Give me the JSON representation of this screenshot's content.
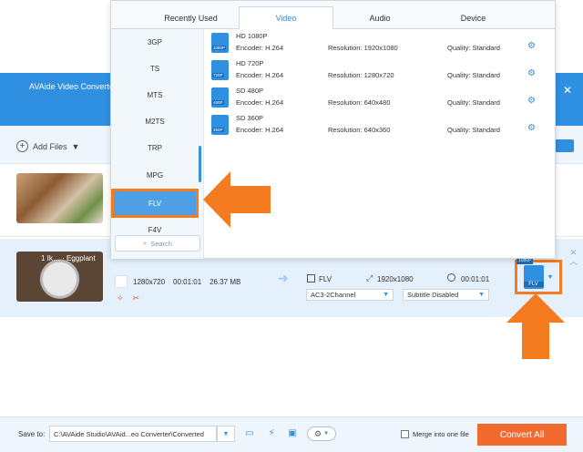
{
  "app": {
    "title": "AVAide Video Converter (",
    "close_glyph": "✕"
  },
  "toolbar": {
    "add_files_label": "Add Files",
    "add_files_caret": "▼"
  },
  "file_row": {
    "thumb_title": "1 Ik… · Eggplant",
    "resolution": "1280x720",
    "duration": "00:01:01",
    "size": "26.37 MB",
    "output_format": "FLV",
    "output_resolution": "1920x1080",
    "output_duration": "00:01:01",
    "audio_track": "AC3-2Channel",
    "subtitle": "Subtitle Disabled",
    "format_badge": "FLV",
    "format_tag": "1080P"
  },
  "popup": {
    "tabs": [
      {
        "label": "Recently Used"
      },
      {
        "label": "Video"
      },
      {
        "label": "Audio"
      },
      {
        "label": "Device"
      }
    ],
    "active_tab": "Video",
    "categories": [
      "3GP",
      "TS",
      "MTS",
      "M2TS",
      "TRP",
      "MPG",
      "FLV",
      "F4V"
    ],
    "selected_category": "FLV",
    "search_placeholder": "Search",
    "presets": [
      {
        "name": "HD 1080P",
        "icon_label": "1080P",
        "encoder": "Encoder: H.264",
        "resolution": "Resolution: 1920x1080",
        "quality": "Quality: Standard"
      },
      {
        "name": "HD 720P",
        "icon_label": "720P",
        "encoder": "Encoder: H.264",
        "resolution": "Resolution: 1280x720",
        "quality": "Quality: Standard"
      },
      {
        "name": "SD 480P",
        "icon_label": "480P",
        "encoder": "Encoder: H.264",
        "resolution": "Resolution: 640x480",
        "quality": "Quality: Standard"
      },
      {
        "name": "SD 360P",
        "icon_label": "360P",
        "encoder": "Encoder: H.264",
        "resolution": "Resolution: 640x360",
        "quality": "Quality: Standard"
      }
    ]
  },
  "bottom": {
    "save_to_label": "Save to:",
    "save_path": "C:\\AVAide Studio\\AVAid...eo Converter\\Converted",
    "merge_label": "Merge into one file",
    "convert_all_label": "Convert All"
  },
  "colors": {
    "accent": "#2f8fe0",
    "highlight_orange": "#f47b20",
    "convert_button": "#f26a2e"
  }
}
